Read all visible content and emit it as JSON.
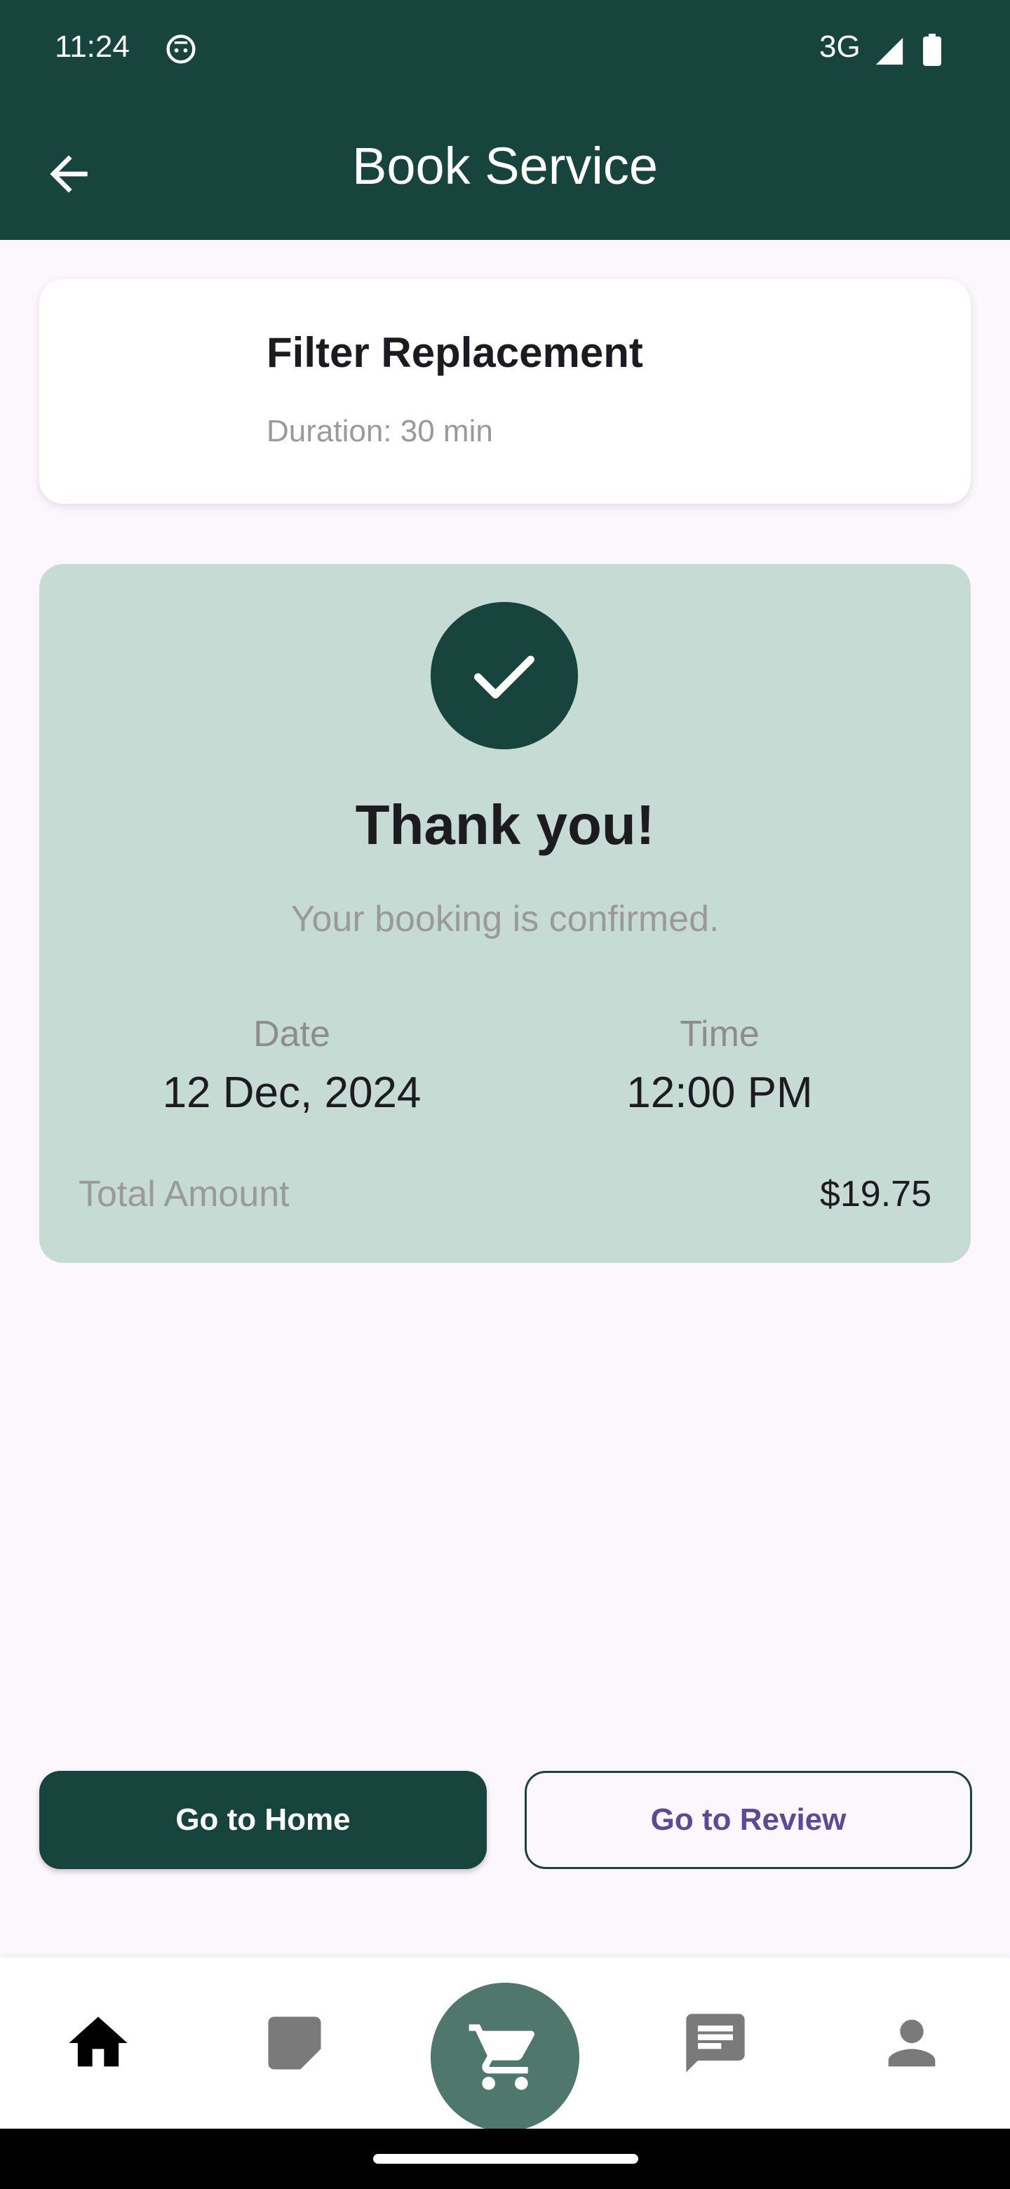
{
  "status_bar": {
    "time": "11:24",
    "network": "3G"
  },
  "app_bar": {
    "title": "Book Service"
  },
  "service": {
    "name": "Filter Replacement",
    "duration": "Duration: 30 min"
  },
  "confirmation": {
    "heading": "Thank you!",
    "message": "Your booking is confirmed.",
    "date_label": "Date",
    "date_value": "12 Dec, 2024",
    "time_label": "Time",
    "time_value": "12:00 PM",
    "total_label": "Total Amount",
    "total_value": "$19.75"
  },
  "buttons": {
    "home": "Go to Home",
    "review": "Go to Review"
  },
  "bottom_nav": {
    "items": [
      {
        "icon": "home-icon",
        "active": true
      },
      {
        "icon": "document-icon",
        "active": false
      },
      {
        "icon": "cart-icon",
        "active": false
      },
      {
        "icon": "chat-icon",
        "active": false
      },
      {
        "icon": "person-icon",
        "active": false
      }
    ]
  },
  "colors": {
    "primary": "#17443c",
    "card_bg": "#c5dbd3",
    "page_bg": "#fcf6fd",
    "accent_text": "#5d4a94",
    "cart_bg": "#4f776c"
  }
}
